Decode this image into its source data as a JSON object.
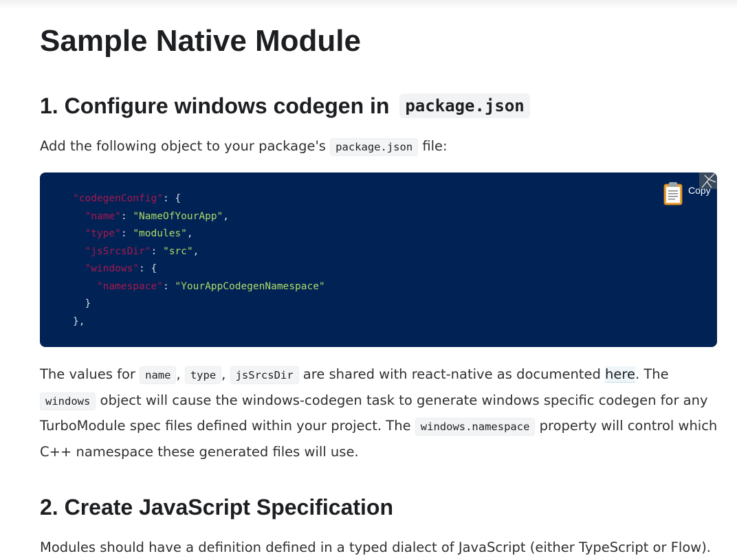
{
  "page_title": "Sample Native Module",
  "section1": {
    "heading_text": "1. Configure windows codegen in",
    "heading_code": "package.json",
    "intro_before": "Add the following object to your package's",
    "intro_code": "package.json",
    "intro_after": "file:"
  },
  "code_block": {
    "lines": [
      [
        {
          "t": "k",
          "v": "\"codegenConfig\""
        },
        {
          "t": "p",
          "v": ": {"
        }
      ],
      [
        {
          "t": "p",
          "v": "  "
        },
        {
          "t": "k",
          "v": "\"name\""
        },
        {
          "t": "p",
          "v": ": "
        },
        {
          "t": "s",
          "v": "\"NameOfYourApp\""
        },
        {
          "t": "p",
          "v": ","
        }
      ],
      [
        {
          "t": "p",
          "v": "  "
        },
        {
          "t": "k",
          "v": "\"type\""
        },
        {
          "t": "p",
          "v": ": "
        },
        {
          "t": "s",
          "v": "\"modules\""
        },
        {
          "t": "p",
          "v": ","
        }
      ],
      [
        {
          "t": "p",
          "v": "  "
        },
        {
          "t": "k",
          "v": "\"jsSrcsDir\""
        },
        {
          "t": "p",
          "v": ": "
        },
        {
          "t": "s",
          "v": "\"src\""
        },
        {
          "t": "p",
          "v": ","
        }
      ],
      [
        {
          "t": "p",
          "v": "  "
        },
        {
          "t": "k",
          "v": "\"windows\""
        },
        {
          "t": "p",
          "v": ": {"
        }
      ],
      [
        {
          "t": "p",
          "v": "    "
        },
        {
          "t": "k",
          "v": "\"namespace\""
        },
        {
          "t": "p",
          "v": ": "
        },
        {
          "t": "s",
          "v": "\"YourAppCodegenNamespace\""
        }
      ],
      [
        {
          "t": "p",
          "v": "  }"
        }
      ],
      [
        {
          "t": "p",
          "v": "},"
        }
      ]
    ],
    "copy_label": "Copy"
  },
  "values_paragraph": {
    "t1": "The values for",
    "c1": "name",
    "t2": ",",
    "c2": "type",
    "t3": ",",
    "c3": "jsSrcsDir",
    "t4": "are shared with react-native as documented",
    "link": "here",
    "t5": ". The",
    "c4": "windows",
    "t6": "object will cause the windows-codegen task to generate windows specific codegen for any TurboModule spec files defined within your project. The",
    "c5": "windows.namespace",
    "t7": "property will control which C++ namespace these generated files will use."
  },
  "section2": {
    "heading_text": "2. Create JavaScript Specification",
    "p1": "Modules should have a definition defined in a typed dialect of JavaScript (either TypeScript or Flow)."
  },
  "colors": {
    "code_bg": "#012255",
    "code_key": "#a5194f",
    "code_string": "#addb67",
    "code_punct": "#d6deeb"
  },
  "icons": {
    "copy": "clipboard-icon",
    "corner": "corner-decoration-icon"
  }
}
